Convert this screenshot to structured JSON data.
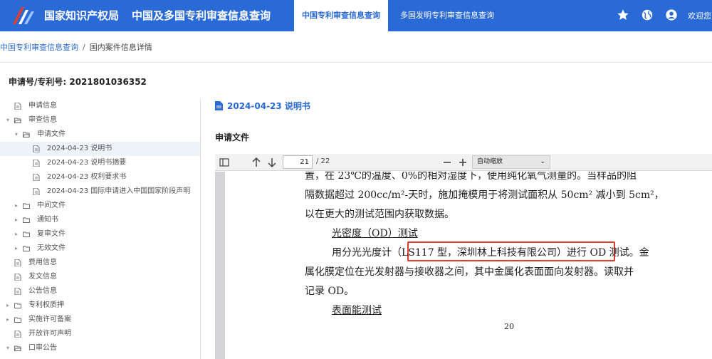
{
  "header": {
    "org": "国家知识产权局",
    "system": "中国及多国专利审查信息查询",
    "tabs": [
      {
        "label": "中国专利审查信息查询",
        "active": true
      },
      {
        "label": "多国发明专利审查信息查询",
        "active": false
      }
    ],
    "icons": [
      "star-icon",
      "globe-icon",
      "user-icon"
    ],
    "welcome": "欢迎您"
  },
  "breadcrumb": {
    "items": [
      "中国专利审查信息查询",
      "国内案件信息详情"
    ],
    "separator": "/"
  },
  "application": {
    "label": "申请号/专利号: 2021801036352"
  },
  "tree": [
    {
      "label": "申请信息",
      "level": 0,
      "icon": "file-icon"
    },
    {
      "label": "审查信息",
      "level": 0,
      "icon": "folder-open-icon",
      "arrow": "down"
    },
    {
      "label": "申请文件",
      "level": 1,
      "icon": "folder-open-icon",
      "arrow": "down"
    },
    {
      "label": "2024-04-23 说明书",
      "level": 2,
      "icon": "file-icon",
      "selected": true
    },
    {
      "label": "2024-04-23 说明书摘要",
      "level": 2,
      "icon": "file-icon"
    },
    {
      "label": "2024-04-23 权利要求书",
      "level": 2,
      "icon": "file-icon"
    },
    {
      "label": "2024-04-23 国际申请进入中国国家阶段声明",
      "level": 2,
      "icon": "file-icon"
    },
    {
      "label": "中间文件",
      "level": 1,
      "icon": "folder-icon",
      "arrow": "right"
    },
    {
      "label": "通知书",
      "level": 1,
      "icon": "folder-icon",
      "arrow": "right"
    },
    {
      "label": "复审文件",
      "level": 1,
      "icon": "folder-icon",
      "arrow": "right"
    },
    {
      "label": "无效文件",
      "level": 1,
      "icon": "folder-icon",
      "arrow": "right"
    },
    {
      "label": "费用信息",
      "level": 0,
      "icon": "file-icon"
    },
    {
      "label": "发文信息",
      "level": 0,
      "icon": "file-icon"
    },
    {
      "label": "公告信息",
      "level": 0,
      "icon": "file-icon"
    },
    {
      "label": "专利权质押",
      "level": 0,
      "icon": "folder-icon",
      "arrow": "right"
    },
    {
      "label": "实施许可备案",
      "level": 0,
      "icon": "folder-icon",
      "arrow": "right"
    },
    {
      "label": "开放许可声明",
      "level": 0,
      "icon": "file-icon"
    },
    {
      "label": "口审公告",
      "level": 0,
      "icon": "folder-open-icon",
      "arrow": "down"
    }
  ],
  "document": {
    "title": "2024-04-23 说明书",
    "section": "申请文件"
  },
  "viewer": {
    "page": "21",
    "total": "/ 22",
    "zoom": "自动缩放",
    "page_number": "20",
    "lines": [
      {
        "text": "置，在 23℃的温度、0%的相对湿度下，使用纯化氧气测量的。当样品的阻",
        "indent": false
      },
      {
        "text": "隔数据超过 200cc/m²-天时，施加掩模用于将测试面积从 50cm² 减小到 5cm²，",
        "indent": false
      },
      {
        "text": "以在更大的测试范围内获取数据。",
        "indent": false
      },
      {
        "text": "光密度（OD）测试",
        "indent": true,
        "underline": true
      },
      {
        "text": "用分光光度计（LS117 型，深圳林上科技有限公司）进行 OD 测试。金",
        "indent": true
      },
      {
        "text": "属化膜定位在光发射器与接收器之间，其中金属化表面面向发射器。读取并",
        "indent": false
      },
      {
        "text": "记录 OD。",
        "indent": false
      },
      {
        "text": "表面能测试",
        "indent": true,
        "underline": true
      }
    ]
  },
  "colors": {
    "brand": "#2a6ad6",
    "highlight": "#e23c2d"
  }
}
